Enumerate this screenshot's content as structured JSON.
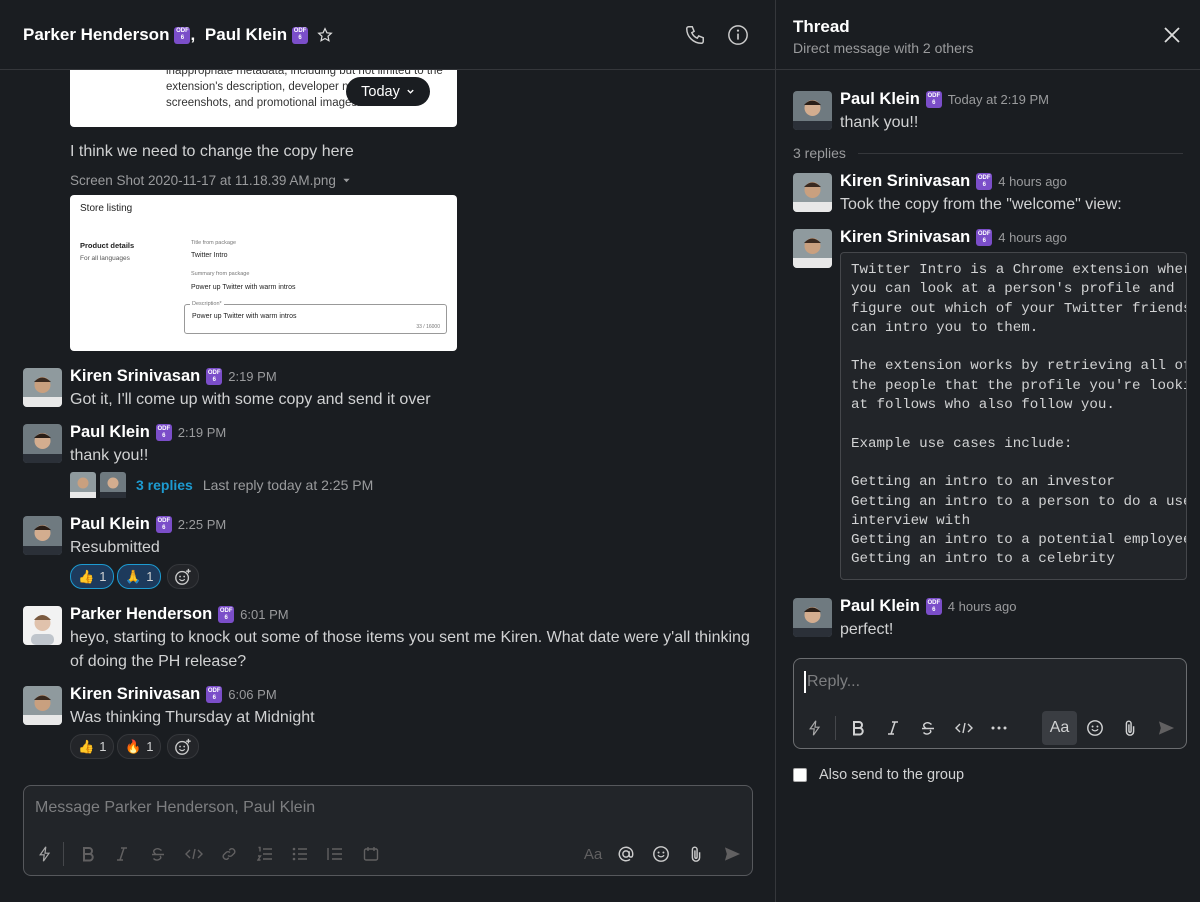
{
  "header": {
    "names": "Parker Henderson",
    "sep": ", ",
    "name2": "Paul Klein",
    "badge_top": "ODF",
    "badge_bottom": "6"
  },
  "top_attachment": {
    "lines": [
      "inappropriate metadata, including but not limited to the",
      "extension's description, developer name",
      "screenshots, and promotional images."
    ],
    "today_label": "Today"
  },
  "msg_copy": {
    "text": "I think we need to change the copy here",
    "filename": "Screen Shot 2020-11-17 at 11.18.39 AM.png",
    "shot": {
      "title": "Store listing",
      "section": "Product details",
      "section_sub": "For all languages",
      "title_label": "Title from package",
      "title_value": "Twitter Intro",
      "summary_label": "Summary from package",
      "summary_value": "Power up Twitter with warm intros",
      "desc_label": "Description*",
      "desc_value": "Power up Twitter with warm intros",
      "counter": "33 / 16000"
    }
  },
  "messages": [
    {
      "name": "Kiren Srinivasan",
      "time": "2:19 PM",
      "text": "Got it, I'll come up with some copy and send it over"
    },
    {
      "name": "Paul Klein",
      "time": "2:19 PM",
      "text": "thank you!!",
      "replies": "3 replies",
      "last_reply": "Last reply today at 2:25 PM"
    },
    {
      "name": "Paul Klein",
      "time": "2:25 PM",
      "text": "Resubmitted",
      "reactions": [
        {
          "emoji": "👍",
          "count": "1"
        },
        {
          "emoji": "🙏",
          "count": "1"
        }
      ]
    },
    {
      "name": "Parker Henderson",
      "time": "6:01 PM",
      "text": "heyo, starting to knock out some of those items you sent me Kiren. What date were y'all thinking",
      "text2": "of doing the PH release?"
    },
    {
      "name": "Kiren Srinivasan",
      "time": "6:06 PM",
      "text": "Was thinking Thursday at Midnight",
      "reactions": [
        {
          "emoji": "👍",
          "count": "1"
        },
        {
          "emoji": "🔥",
          "count": "1"
        }
      ]
    }
  ],
  "composer": {
    "placeholder": "Message Parker Henderson, Paul Klein",
    "aa": "Aa"
  },
  "thread": {
    "title": "Thread",
    "subtitle": "Direct message with 2 others",
    "parent": {
      "name": "Paul Klein",
      "time": "Today at 2:19 PM",
      "text": "thank you!!"
    },
    "replies_label": "3 replies",
    "replies": [
      {
        "name": "Kiren Srinivasan",
        "time": "4 hours ago",
        "text": "Took the copy from the \"welcome\" view:"
      },
      {
        "name": "Kiren Srinivasan",
        "time": "4 hours ago",
        "code": "Twitter Intro is a Chrome extension where\nyou can look at a person's profile and\nfigure out which of your Twitter friends\ncan intro you to them.\n\nThe extension works by retrieving all of\nthe people that the profile you're looking\nat follows who also follow you.\n\nExample use cases include:\n\nGetting an intro to an investor\nGetting an intro to a person to do a user\ninterview with\nGetting an intro to a potential employee\nGetting an intro to a celebrity"
      },
      {
        "name": "Paul Klein",
        "time": "4 hours ago",
        "text": "perfect!"
      }
    ],
    "reply_placeholder": "Reply...",
    "aa": "Aa",
    "also_send": "Also send to the group"
  },
  "colors": {
    "bg": "#1a1d21",
    "link": "#1d9bd1",
    "badge": "#7b4ec9"
  }
}
